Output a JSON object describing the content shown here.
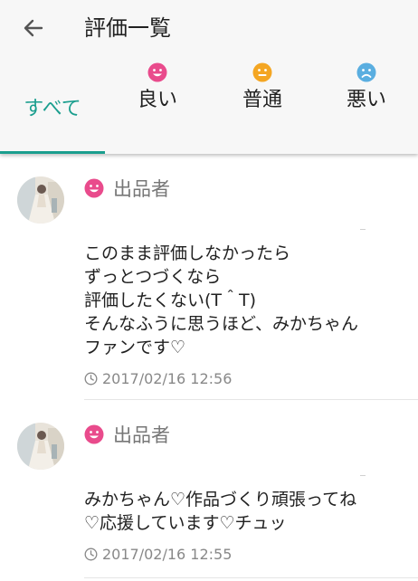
{
  "header": {
    "title": "評価一覧"
  },
  "tabs": [
    {
      "label": "すべて"
    },
    {
      "label": "良い",
      "icon": "smile-icon",
      "color": "#e94b8c"
    },
    {
      "label": "普通",
      "icon": "neutral-face-icon",
      "color": "#f4a623"
    },
    {
      "label": "悪い",
      "icon": "sad-face-icon",
      "color": "#5aaee0"
    }
  ],
  "colors": {
    "accent": "#1a9e8e",
    "good": "#e94b8c",
    "normal": "#f4a623",
    "bad": "#5aaee0"
  },
  "reviews": [
    {
      "role": "出品者",
      "rating_icon": "smile-icon",
      "lines": [
        "このまま評価しなかったら",
        "ずっとつづくなら",
        "評価したくない(T＾T)",
        "そんなふうに思うほど、みかちゃん",
        "ファンです♡"
      ],
      "date": "2017/02/16 12:56"
    },
    {
      "role": "出品者",
      "rating_icon": "smile-icon",
      "lines": [
        "みかちゃん♡作品づくり頑張ってね",
        "♡応援しています♡チュッ"
      ],
      "date": "2017/02/16 12:55"
    }
  ]
}
